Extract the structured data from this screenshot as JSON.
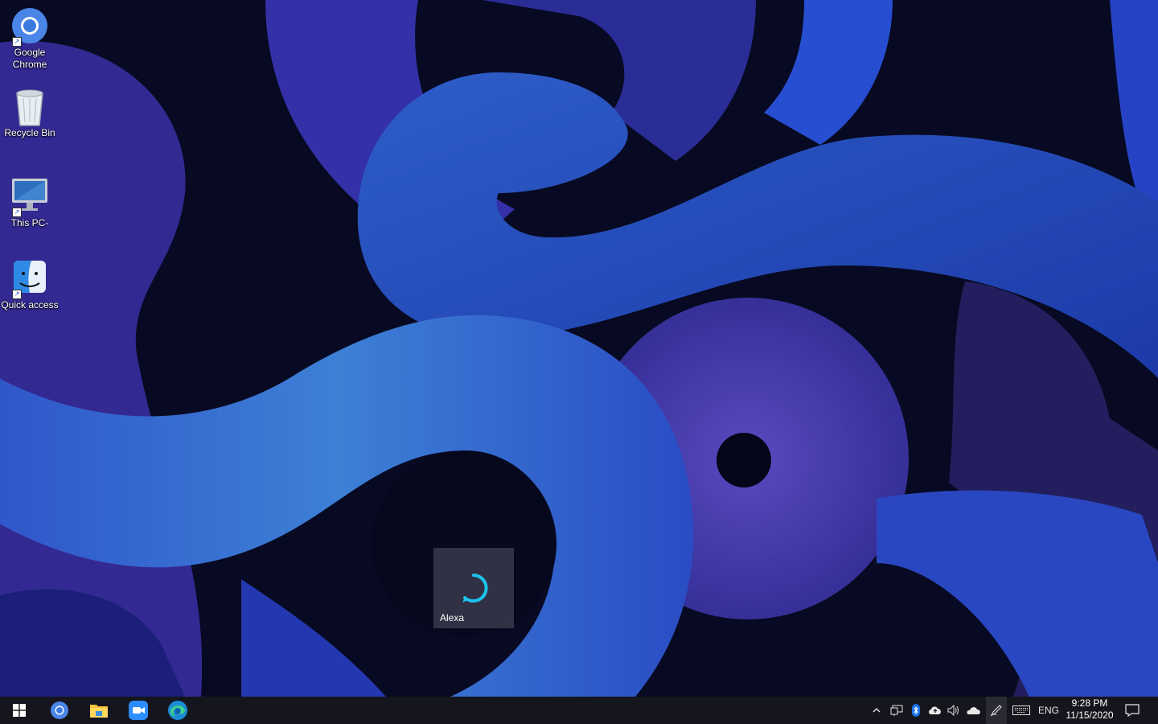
{
  "desktop": {
    "icons": [
      {
        "label": "Google Chrome",
        "icon": "chrome-icon"
      },
      {
        "label": "Recycle Bin",
        "icon": "recycle-bin-icon"
      },
      {
        "label": "This PC-",
        "icon": "monitor-icon"
      },
      {
        "label": "Quick access",
        "icon": "finder-face-icon"
      }
    ],
    "tile": {
      "label": "Alexa",
      "icon": "alexa-ring-icon",
      "accent": "#1fc2ec"
    }
  },
  "taskbar": {
    "pinned": [
      {
        "name": "start",
        "icon": "windows-logo-icon"
      },
      {
        "name": "chrome",
        "icon": "chrome-icon"
      },
      {
        "name": "file-explorer",
        "icon": "folder-icon"
      },
      {
        "name": "zoom",
        "icon": "zoom-icon"
      },
      {
        "name": "edge",
        "icon": "edge-icon"
      }
    ],
    "tray_icons": [
      "chevron-up-icon",
      "network-icon",
      "bluetooth-icon",
      "cloud-upload-icon",
      "volume-icon",
      "onedrive-icon",
      "pen-icon",
      "keyboard-icon"
    ],
    "language": "ENG",
    "time": "9:28 PM",
    "date": "11/15/2020",
    "notification_icon": "action-center-icon"
  },
  "colors": {
    "taskbar": "#15151d",
    "wallpaper_dark": "#050716",
    "wallpaper_blue": "#3a7fd5",
    "wallpaper_purple": "#4a3aa8"
  }
}
